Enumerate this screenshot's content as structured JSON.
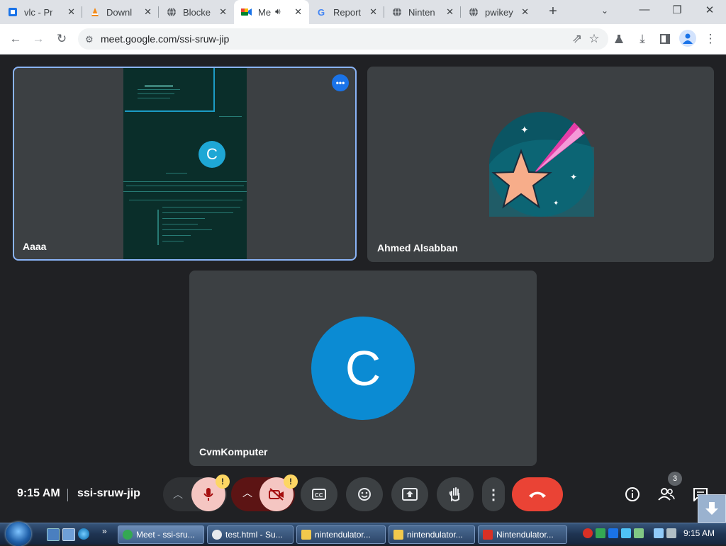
{
  "browser": {
    "tabs": [
      {
        "title": "vlc - Pr",
        "icon": "document-icon"
      },
      {
        "title": "Downl",
        "icon": "vlc-cone-icon"
      },
      {
        "title": "Blocke",
        "icon": "globe-icon"
      },
      {
        "title": "Me",
        "icon": "meet-icon",
        "active": true,
        "audio": true
      },
      {
        "title": "Report",
        "icon": "google-icon"
      },
      {
        "title": "Ninten",
        "icon": "globe-icon"
      },
      {
        "title": "pwikey",
        "icon": "globe-icon"
      }
    ],
    "url": "meet.google.com/ssi-sruw-jip"
  },
  "meet": {
    "participants": [
      {
        "name": "Aaaa",
        "video_avatar_letter": "C"
      },
      {
        "name": "Ahmed Alsabban"
      },
      {
        "name": "CvmKomputer",
        "avatar_letter": "C"
      }
    ],
    "time": "9:15 AM",
    "meeting_code": "ssi-sruw-jip",
    "warning_mark": "!",
    "people_count": "3",
    "colors": {
      "leave": "#ea4335",
      "mic_off": "#f5c6c2",
      "accent": "#8ab4f8",
      "avatar": "#0b8bd3"
    }
  },
  "taskbar": {
    "items": [
      {
        "label": "Meet - ssi-sru...",
        "active": true
      },
      {
        "label": "test.html - Su..."
      },
      {
        "label": "nintendulator..."
      },
      {
        "label": "nintendulator..."
      },
      {
        "label": "Nintendulator..."
      }
    ],
    "more": "»",
    "clock": "9:15 AM"
  }
}
